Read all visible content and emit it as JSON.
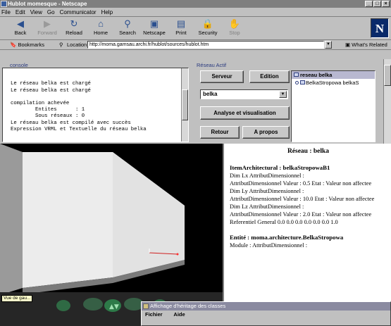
{
  "window": {
    "title": "Hublot momesque - Netscape",
    "controls": [
      "_",
      "□",
      "×"
    ]
  },
  "menu": [
    "File",
    "Edit",
    "View",
    "Go",
    "Communicator",
    "Help"
  ],
  "toolbar": [
    {
      "label": "Back",
      "icon": "back-arrow-icon",
      "glyph": "◀",
      "enabled": true
    },
    {
      "label": "Forward",
      "icon": "forward-arrow-icon",
      "glyph": "▶",
      "enabled": false
    },
    {
      "label": "Reload",
      "icon": "reload-icon",
      "glyph": "↻",
      "enabled": true
    },
    {
      "label": "Home",
      "icon": "home-icon",
      "glyph": "⌂",
      "enabled": true
    },
    {
      "label": "Search",
      "icon": "search-icon",
      "glyph": "⚲",
      "enabled": true
    },
    {
      "label": "Netscape",
      "icon": "netscape-icon",
      "glyph": "▣",
      "enabled": true
    },
    {
      "label": "Print",
      "icon": "print-icon",
      "glyph": "▤",
      "enabled": true
    },
    {
      "label": "Security",
      "icon": "security-lock-icon",
      "glyph": "🔒",
      "enabled": true
    },
    {
      "label": "Stop",
      "icon": "stop-icon",
      "glyph": "✋",
      "enabled": false
    }
  ],
  "logo": "N",
  "location": {
    "bookmarks_label": "Bookmarks",
    "location_label": "Location:",
    "url": "http://moma.gamsau.archi.fr/hublot/sources/hublot.htm",
    "whats_related": "What's Related"
  },
  "console": {
    "label": "console",
    "lines": [
      "Le réseau belka est chargé",
      "Le réseau belka est chargé",
      "",
      "compilation achevée",
      "        Entites      : 1",
      "        Sous réseaux : 0",
      "Le réseau belka est compilé avec succès",
      "Expression VRML et Textuelle du réseau belka"
    ]
  },
  "reseau": {
    "label": "Réseau Actif",
    "serveur": "Serveur",
    "edition": "Edition",
    "selected": "belka",
    "analyse": "Analyse et visualisation",
    "retour": "Retour",
    "apropos": "A propos"
  },
  "tree": {
    "root": "reseau belka",
    "child": "BelkaStropowa belkaS"
  },
  "viewer": {
    "label": "Vue de gau..."
  },
  "panel": {
    "title": "Réseau : belka",
    "item_heading": "ItemArchitectural : belkaStropowaB1",
    "item_lines": [
      "Dim Lx AttributDimensionnel :",
      "AttributDimensionnel Valeur : 0.5 Etat : Valeur non affectee",
      "Dim Ly AttributDimensionnel :",
      "AttributDimensionnel Valeur : 10.0 Etat : Valeur non affectee",
      "Dim Lz AttributDimensionnel :",
      "AttributDimensionnel Valeur : 2.0 Etat : Valeur non affectee",
      "Referentiel General 0.0 0.0 0.0 0.0 0.0 0.0 1.0"
    ],
    "entity_heading": "Entité : moma.architecture.BelkaStropowa",
    "entity_lines": [
      "Module : AttributDimensionnel :"
    ]
  },
  "dialog": {
    "title": "Affichage d'héritage des classes",
    "menu": [
      "Fichier",
      "Aide"
    ]
  }
}
